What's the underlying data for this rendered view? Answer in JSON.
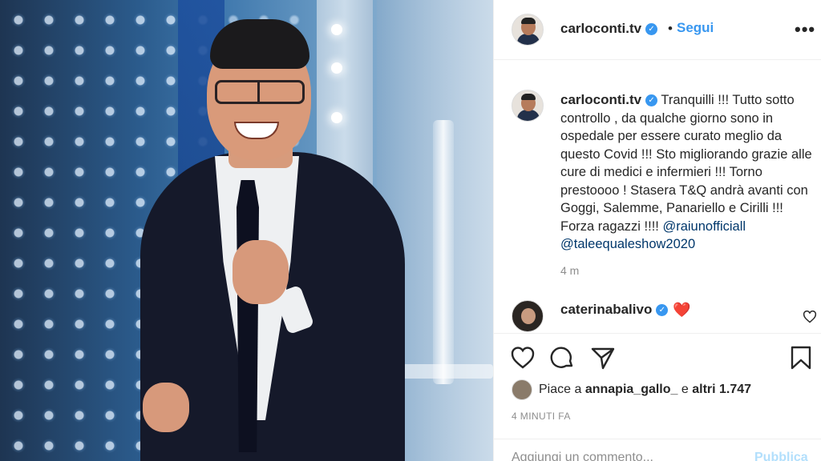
{
  "post": {
    "username": "carloconti.tv",
    "verified_icon": "verified-badge-icon",
    "follow_separator": "•",
    "follow_label": "Segui",
    "more_label": "•••",
    "caption": {
      "text": "Tranquilli !!! Tutto sotto controllo , da qualche giorno sono in ospedale per essere curato meglio da questo Covid !!! Sto migliorando grazie alle cure di medici e infermieri !!! Torno prestoooo ! Stasera T&Q andrà avanti con Goggi, Salemme, Panariello e Cirilli !!! Forza ragazzi !!!! ",
      "mention1": "@raiunofficiall",
      "mention2": "@taleequaleshow2020"
    },
    "caption_age": "4 m",
    "comment": {
      "username": "caterinabalivo",
      "emoji": "❤️"
    },
    "likes": {
      "prefix": "Piace a",
      "user": "annapia_gallo_",
      "joiner": "e",
      "others": "altri 1.747"
    },
    "timestamp": "4 MINUTI FA",
    "add_comment": {
      "placeholder": "Aggiungi un commento...",
      "publish_label": "Pubblica"
    }
  },
  "colors": {
    "accent": "#3897f0",
    "mention": "#00376b",
    "muted": "#8e8e8e",
    "heart": "#e0245e"
  }
}
